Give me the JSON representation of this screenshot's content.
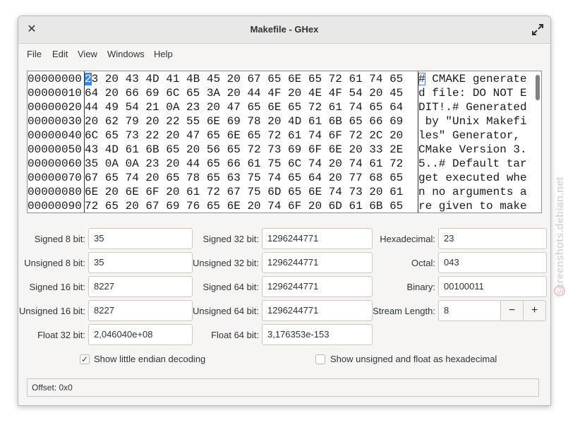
{
  "window": {
    "title": "Makefile - GHex"
  },
  "menu": [
    "File",
    "Edit",
    "View",
    "Windows",
    "Help"
  ],
  "hex_view": {
    "rows": [
      {
        "offset": "00000000",
        "hex": "23 20 43 4D 41 4B 45 20 67 65 6E 65 72 61 74 65",
        "ascii": "# CMAKE generate"
      },
      {
        "offset": "00000010",
        "hex": "64 20 66 69 6C 65 3A 20 44 4F 20 4E 4F 54 20 45",
        "ascii": "d file: DO NOT E"
      },
      {
        "offset": "00000020",
        "hex": "44 49 54 21 0A 23 20 47 65 6E 65 72 61 74 65 64",
        "ascii": "DIT!.# Generated"
      },
      {
        "offset": "00000030",
        "hex": "20 62 79 20 22 55 6E 69 78 20 4D 61 6B 65 66 69",
        "ascii": " by \"Unix Makefi"
      },
      {
        "offset": "00000040",
        "hex": "6C 65 73 22 20 47 65 6E 65 72 61 74 6F 72 2C 20",
        "ascii": "les\" Generator, "
      },
      {
        "offset": "00000050",
        "hex": "43 4D 61 6B 65 20 56 65 72 73 69 6F 6E 20 33 2E",
        "ascii": "CMake Version 3."
      },
      {
        "offset": "00000060",
        "hex": "35 0A 0A 23 20 44 65 66 61 75 6C 74 20 74 61 72",
        "ascii": "5..# Default tar"
      },
      {
        "offset": "00000070",
        "hex": "67 65 74 20 65 78 65 63 75 74 65 64 20 77 68 65",
        "ascii": "get executed whe"
      },
      {
        "offset": "00000080",
        "hex": "6E 20 6E 6F 20 61 72 67 75 6D 65 6E 74 73 20 61",
        "ascii": "n no arguments a"
      },
      {
        "offset": "00000090",
        "hex": "72 65 20 67 69 76 65 6E 20 74 6F 20 6D 61 6B 65",
        "ascii": "re given to make"
      }
    ]
  },
  "fields": {
    "signed8": {
      "label": "Signed 8 bit:",
      "value": "35"
    },
    "unsigned8": {
      "label": "Unsigned 8 bit:",
      "value": "35"
    },
    "signed16": {
      "label": "Signed 16 bit:",
      "value": "8227"
    },
    "unsigned16": {
      "label": "Unsigned 16 bit:",
      "value": "8227"
    },
    "float32": {
      "label": "Float 32 bit:",
      "value": "2,046040e+08"
    },
    "signed32": {
      "label": "Signed 32 bit:",
      "value": "1296244771"
    },
    "unsigned32": {
      "label": "Unsigned 32 bit:",
      "value": "1296244771"
    },
    "signed64": {
      "label": "Signed 64 bit:",
      "value": "1296244771"
    },
    "unsigned64": {
      "label": "Unsigned 64 bit:",
      "value": "1296244771"
    },
    "float64": {
      "label": "Float 64 bit:",
      "value": "3,176353e-153"
    },
    "hexadecimal": {
      "label": "Hexadecimal:",
      "value": "23"
    },
    "octal": {
      "label": "Octal:",
      "value": "043"
    },
    "binary": {
      "label": "Binary:",
      "value": "00100011"
    },
    "stream_length": {
      "label": "Stream Length:",
      "value": "8",
      "minus": "−",
      "plus": "+"
    }
  },
  "options": {
    "little_endian": {
      "label": "Show little endian decoding",
      "checked": true,
      "mark": "✓"
    },
    "unsigned_hex": {
      "label": "Show unsigned and float as hexadecimal",
      "checked": false
    }
  },
  "status": {
    "offset_text": "Offset: 0x0"
  },
  "watermark": {
    "text": "screenshots.debian.net"
  }
}
